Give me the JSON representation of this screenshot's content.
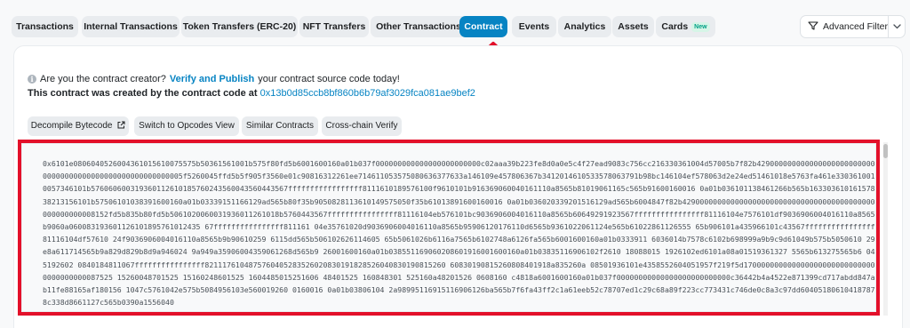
{
  "tabs": [
    {
      "label": "Transactions",
      "active": false
    },
    {
      "label": "Internal Transactions",
      "active": false
    },
    {
      "label": "Token Transfers (ERC-20)",
      "active": false
    },
    {
      "label": "NFT Transfers",
      "active": false
    },
    {
      "label": "Other Transactions",
      "active": false
    },
    {
      "label": "Contract",
      "active": true
    },
    {
      "label": "Events",
      "active": false
    },
    {
      "label": "Analytics",
      "active": false
    },
    {
      "label": "Assets",
      "active": false
    },
    {
      "label": "Cards",
      "active": false,
      "badge": "New"
    }
  ],
  "filter": {
    "label": "Advanced Filter",
    "icon": "filter-icon",
    "dropdown_icon": "chevron-down-icon"
  },
  "notice": {
    "prefix": "Are you the contract creator?",
    "link": "Verify and Publish",
    "suffix": "your contract source code today!",
    "icon": "info-icon"
  },
  "creator": {
    "text": "This contract was created by the contract code at",
    "address": "0x13b0d85ccb8bf860b6b79af3029fca081ae9bef2"
  },
  "actions": [
    {
      "label": "Decompile Bytecode",
      "icon": "external-link-icon"
    },
    {
      "label": "Switch to Opcodes View"
    },
    {
      "label": "Similar Contracts"
    },
    {
      "label": "Cross-chain Verify"
    }
  ],
  "bytecode": "0x6101e0806040526004361015610075575b50361561001b575f80fd5b6001600160a01b037f000000000000000000000000c02aaa39b223fe8d0a0e5c4f27ead9083c756cc216330361004d57005b7f82b42900000000000000000000000000000000000000000000000000000005f5260045ffd5b5f905f3560e01c90816312261ee714611053575080636377633a146109e457806367b3412014610533578063791b98bc146104ef578063d2e24ed51461018e5763fa461e3303610010057346101b576060600319360112610185760243560043560443567fffffffffffffffff8111610189576100f9610101b916369060040161110a8565b81019061165c565b91600160016 0a01b036101138461266b565b16330361016157838213156101b57506101038391600160a01b03339151166129ad565b80f35b9050828113610149575050f35b61013891600160016 0a01b036020339201516129ad565b6004847f82b42900000000000000000000000000000000000000000000000000008152fd5b835b80fd5b5061020060031936011261018b5760443567ffffffffffffffff81116104eb576101bc9036906004016110a8565b60649291923567ffffffffffffffff81116104e7576101df9036906004016110a8565b9060a060083193601126101895761012435 67ffffffffffffffff811161 04e35761020d9036906004016110a8565b95906120176110d6565b9361022061124e565b61022861126555 65b906101a435966101c43567ffffffffffffffff81116104df57610 24f9036906004016110a8565b9b90610259 6115dd565b506102626114605 65b5061026b6116a7565b6102748a6126fa565b6001600160a01b0333911 6036014b7578c6102b698999a9b9c9d61049b575b5050610 29e8a611714565b9a829d829b8d9a946024 9a949a35906004359061268d565b9 26001600160a01b038551169060208601916001600160a01b03835116906102f2610 18088015 1926102ed6101a08a01519361327 5565b613275565b6 045192602 0840184811067ffffffffffffffff8211176104875760405283526020830191828526040830190815260 60830190815260808401918a835260a 08501936101e4358552604051957f219f5d1700000000000000000000000000000000000000087525 15260048701525 15160248601525 1604485015251606 48401525 160848301 525160a48201526 0608160 c4818a6001600160a01b037f00000000000000000000000000c36442b4a4522e871399cd717abdd847ab11fe88165af180156 1047c5761042e575b5084956103e560019260 0160016 0a01b03806104 2a98995116915116906126ba565b7f6fa43ff2c1a61eeb52c78707ed1c29c68a89f223cc773431c746de0c8a3c97dd60405180610418787 8c338d8661127c565b0390a1556040"
}
